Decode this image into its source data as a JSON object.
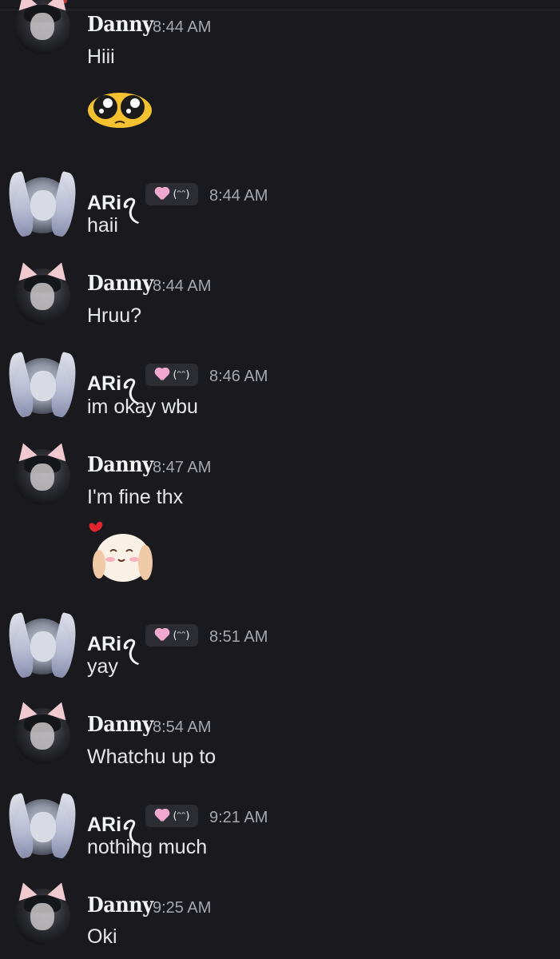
{
  "chat": {
    "messages": [
      {
        "author": "Danny",
        "time": "8:44 AM",
        "text": "Hiii",
        "sticker": "pleading-eyes-emoji"
      },
      {
        "author": "ARi",
        "author_suffix": "ꪖ",
        "badge_kaomoji": "(ᵔᵔ)",
        "time": "8:44 AM",
        "text": "haii"
      },
      {
        "author": "Danny",
        "time": "8:44 AM",
        "text": "Hruu?"
      },
      {
        "author": "ARi",
        "author_suffix": "ꪖ",
        "badge_kaomoji": "(ᵔᵔ)",
        "time": "8:46 AM",
        "text": "im okay wbu"
      },
      {
        "author": "Danny",
        "time": "8:47 AM",
        "text": "I'm fine thx",
        "sticker": "bunny-heart-sticker"
      },
      {
        "author": "ARi",
        "author_suffix": "ꪖ",
        "badge_kaomoji": "(ᵔᵔ)",
        "time": "8:51 AM",
        "text": "yay"
      },
      {
        "author": "Danny",
        "time": "8:54 AM",
        "text": "Whatchu up to"
      },
      {
        "author": "ARi",
        "author_suffix": "ꪖ",
        "badge_kaomoji": "(ᵔᵔ)",
        "time": "9:21 AM",
        "text": "nothing much"
      },
      {
        "author": "Danny",
        "time": "9:25 AM",
        "text": "Oki"
      }
    ]
  },
  "colors": {
    "background": "#1a1a1e",
    "name": "#f2f3f5",
    "timestamp": "#a5a8b0",
    "message_text": "#e6e7ea",
    "badge_bg": "#2b2d33",
    "badge_heart": "#f2a9cf"
  }
}
